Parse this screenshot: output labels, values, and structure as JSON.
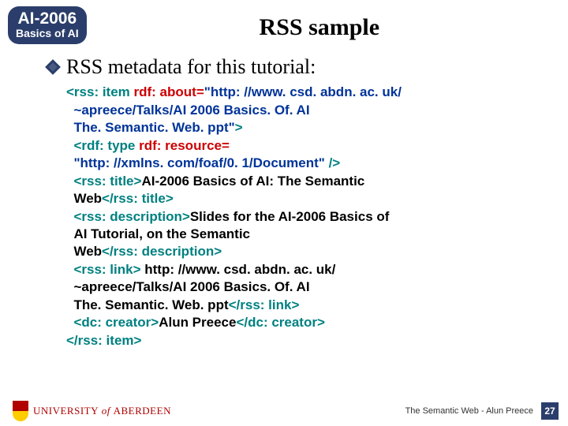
{
  "badge": {
    "top": "AI-2006",
    "bottom": "Basics of AI"
  },
  "title": "RSS sample",
  "bullet": "RSS metadata for this tutorial:",
  "code": {
    "l1a": "<rss: item ",
    "l1b": "rdf: about=",
    "l1c": "\"http: //www. csd. abdn. ac. uk/",
    "l2": "  ~apreece/Talks/AI 2006 Basics. Of. AI",
    "l3": "  The. Semantic. Web. ppt\"",
    "l3b": ">",
    "l4a": "  <rdf: type ",
    "l4b": "rdf: resource=",
    "l5": "  \"http: //xmlns. com/foaf/0. 1/Document\" ",
    "l5b": "/>",
    "l6a": "  <rss: title>",
    "l6b": "AI-2006 Basics of AI: The Semantic",
    "l7a": "  Web",
    "l7b": "</rss: title>",
    "l8a": "  <rss: description>",
    "l8b": "Slides for the AI-2006 Basics of",
    "l9": "  AI Tutorial, on the Semantic",
    "l10a": "  Web",
    "l10b": "</rss: description>",
    "l11a": "  <rss: link>",
    "l11b": " http: //www. csd. abdn. ac. uk/",
    "l12": "  ~apreece/Talks/AI 2006 Basics. Of. AI",
    "l13a": "  The. Semantic. Web. ppt",
    "l13b": "</rss: link>",
    "l14a": "  <dc: creator>",
    "l14b": "Alun Preece",
    "l14c": "</dc: creator>",
    "l15": "</rss: item>"
  },
  "footer": {
    "uni": "UNIVERSITY",
    "of": " of ",
    "aberdeen": "ABERDEEN",
    "text": "The Semantic Web - Alun Preece",
    "page": "27"
  }
}
